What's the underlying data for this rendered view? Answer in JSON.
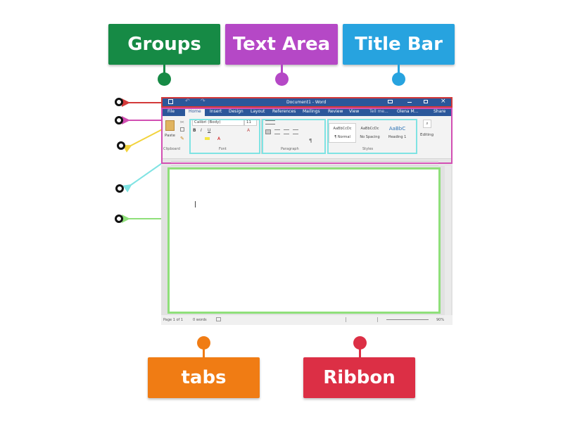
{
  "labels": {
    "groups": "Groups",
    "text_area": "Text Area",
    "title_bar": "Title Bar",
    "tabs": "tabs",
    "ribbon": "Ribbon"
  },
  "colors": {
    "groups": "#168a45",
    "text_area": "#b548c6",
    "title_bar": "#27a3df",
    "tabs": "#f07c14",
    "ribbon": "#dc2f45",
    "green_frame": "#8fe07a",
    "cyan_frame": "#7fe3e3"
  },
  "word": {
    "title": "Document1 - Word",
    "tabs": [
      "File",
      "Home",
      "Insert",
      "Design",
      "Layout",
      "References",
      "Mailings",
      "Review",
      "View"
    ],
    "tell_me": "Tell me...",
    "user": "Olena M...",
    "share": "Share",
    "paste_label": "Paste",
    "font_name": "Calibri (Body)",
    "font_size": "11",
    "group_labels": [
      "Clipboard",
      "Font",
      "Paragraph",
      "Styles"
    ],
    "styles": [
      "AaBbCcDc",
      "AaBbCcDc",
      "AaBbC"
    ],
    "style_names": [
      "¶ Normal",
      "No Spacing",
      "Heading 1"
    ],
    "editing": "Editing",
    "status": {
      "page": "Page 1 of 1",
      "words": "0 words",
      "zoom": "90%"
    }
  }
}
